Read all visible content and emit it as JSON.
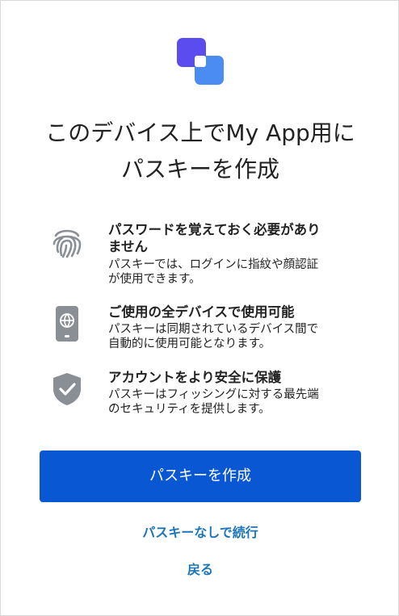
{
  "header": {
    "logo_icon": "app-logo-icon",
    "title_line1": "このデバイス上でMy App用に",
    "title_line2": "パスキーを作成"
  },
  "features": [
    {
      "icon": "fingerprint-icon",
      "heading_line1": "パスワードを覚えておく必要があり",
      "heading_line2": "ません",
      "desc_line1": "パスキーでは、ログインに指紋や顔認証",
      "desc_line2": "が使用できます。"
    },
    {
      "icon": "device-sync-icon",
      "heading_line1": "ご使用の全デバイスで使用可能",
      "desc_line1": "パスキーは同期されているデバイス間で",
      "desc_line2": "自動的に使用可能となります。"
    },
    {
      "icon": "shield-check-icon",
      "heading_line1": "アカウントをより安全に保護",
      "desc_line1": "パスキーはフィッシングに対する最先端",
      "desc_line2": "のセキュリティを提供します。"
    }
  ],
  "actions": {
    "create_label": "パスキーを作成",
    "continue_without_label": "パスキーなしで続行",
    "back_label": "戻る"
  },
  "colors": {
    "primary": "#0a57d4",
    "link": "#1b75b8",
    "logo_back": "#5b4cf0",
    "logo_front": "#4a8cf2",
    "icon_gray": "#8a8f96"
  }
}
